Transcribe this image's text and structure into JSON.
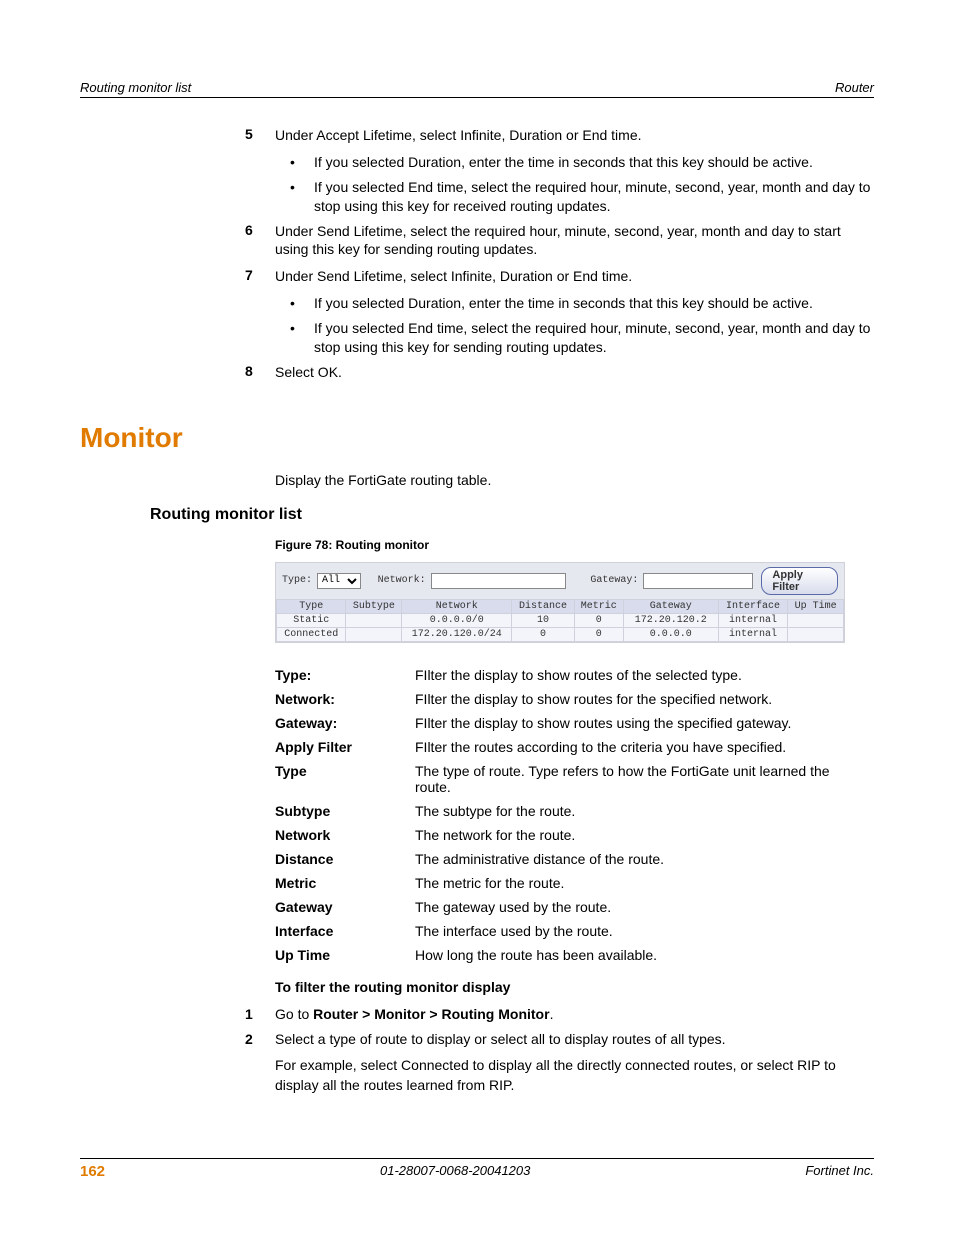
{
  "header": {
    "left": "Routing monitor list",
    "right": "Router"
  },
  "steps_top": [
    {
      "n": "5",
      "text": "Under Accept Lifetime, select Infinite, Duration or End time.",
      "bullets": [
        "If you selected Duration, enter the time in seconds that this key should be active.",
        "If you selected End time, select the required hour, minute, second, year, month and day to stop using this key for received routing updates."
      ]
    },
    {
      "n": "6",
      "text": "Under Send Lifetime, select the required hour, minute, second, year, month and day to start using this key for sending routing updates.",
      "bullets": []
    },
    {
      "n": "7",
      "text": "Under Send Lifetime, select Infinite, Duration or End time.",
      "bullets": [
        "If you selected Duration, enter the time in seconds that this key should be active.",
        "If you selected End time, select the required hour, minute, second, year, month and day to stop using this key for sending routing updates."
      ]
    },
    {
      "n": "8",
      "text": "Select OK.",
      "bullets": []
    }
  ],
  "section_heading": "Monitor",
  "section_intro": "Display the FortiGate routing table.",
  "subsection_heading": "Routing monitor list",
  "figure_caption": "Figure 78: Routing monitor",
  "figure": {
    "type_label": "Type:",
    "type_value": "All",
    "network_label": "Network:",
    "network_value": "",
    "gateway_label": "Gateway:",
    "gateway_value": "",
    "apply_label": "Apply Filter",
    "cols": [
      "Type",
      "Subtype",
      "Network",
      "Distance",
      "Metric",
      "Gateway",
      "Interface",
      "Up Time"
    ],
    "rows": [
      [
        "Static",
        "",
        "0.0.0.0/0",
        "10",
        "0",
        "172.20.120.2",
        "internal",
        ""
      ],
      [
        "Connected",
        "",
        "172.20.120.0/24",
        "0",
        "0",
        "0.0.0.0",
        "internal",
        ""
      ]
    ]
  },
  "defs": [
    {
      "k": "Type:",
      "v": "FIlter the display to show routes of the selected type."
    },
    {
      "k": "Network:",
      "v": "FIlter the display to show routes for the specified network."
    },
    {
      "k": "Gateway:",
      "v": "FIlter the display to show routes using the specified gateway."
    },
    {
      "k": "Apply Filter",
      "v": "FIlter the routes according to the criteria you have specified."
    },
    {
      "k": "Type",
      "v": "The type of route. Type refers to how the FortiGate unit learned the route."
    },
    {
      "k": "Subtype",
      "v": "The subtype for the route."
    },
    {
      "k": "Network",
      "v": "The network for the route."
    },
    {
      "k": "Distance",
      "v": "The administrative distance of the route."
    },
    {
      "k": "Metric",
      "v": "The metric for the route."
    },
    {
      "k": "Gateway",
      "v": "The gateway used by the route."
    },
    {
      "k": "Interface",
      "v": "The interface used by the route."
    },
    {
      "k": "Up Time",
      "v": "How long the route has been available."
    }
  ],
  "proc_heading": "To filter the routing monitor display",
  "proc_steps": {
    "s1_pre": "Go to ",
    "s1_bold": "Router > Monitor > Routing Monitor",
    "s1_post": ".",
    "s2": "Select a type of route to display or select all to display routes of all types.",
    "s2_cont": "For example, select Connected to display all the directly connected routes, or select RIP to display all the routes learned from RIP."
  },
  "footer": {
    "page": "162",
    "docid": "01-28007-0068-20041203",
    "company": "Fortinet Inc."
  }
}
